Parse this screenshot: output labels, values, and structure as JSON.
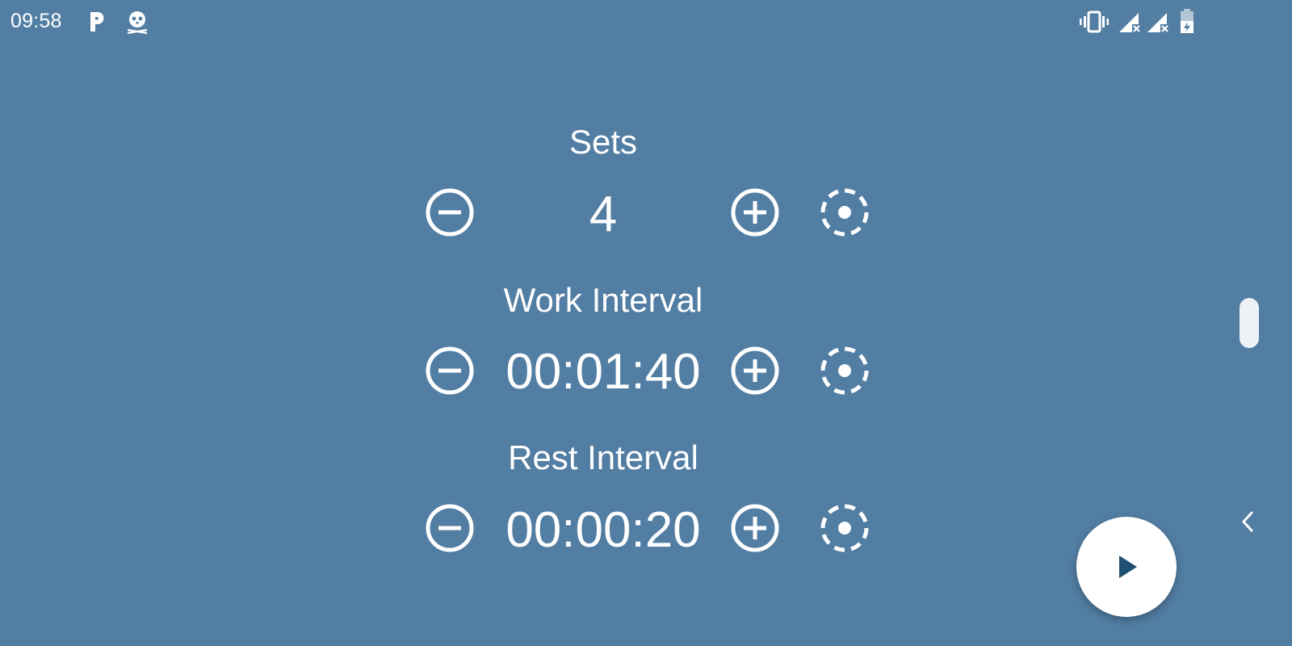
{
  "status_bar": {
    "time": "09:58",
    "left_icons": [
      "parking-icon",
      "pirate-skull-icon"
    ],
    "right_icons": [
      "vibrate-icon",
      "signal-no-service-icon",
      "signal-no-service-icon",
      "battery-charging-icon"
    ]
  },
  "settings": [
    {
      "label": "Sets",
      "value": "4"
    },
    {
      "label": "Work Interval",
      "value": "00:01:40"
    },
    {
      "label": "Rest Interval",
      "value": "00:00:20"
    }
  ],
  "controls": {
    "decrease_icon": "minus-circle-icon",
    "increase_icon": "plus-circle-icon",
    "preset_icon": "dashed-target-icon"
  },
  "fab": {
    "icon": "play-icon"
  },
  "colors": {
    "background": "#527ea3",
    "foreground": "#ffffff",
    "fab_background": "#ffffff",
    "fab_icon": "#1f4f73"
  }
}
